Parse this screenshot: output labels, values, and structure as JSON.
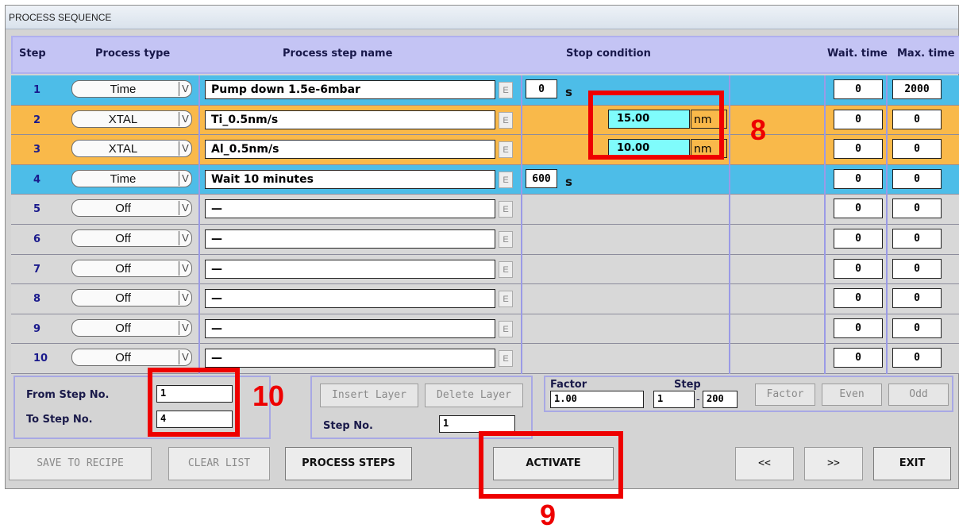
{
  "window": {
    "title": "PROCESS SEQUENCE"
  },
  "header": {
    "step": "Step",
    "process_type": "Process type",
    "process_step_name": "Process step name",
    "stop_condition": "Stop condition",
    "wait_time": "Wait. time",
    "max_time": "Max. time"
  },
  "colors": {
    "time_row": "#4dbde8",
    "xtal_row": "#f9b94a",
    "off_row": "#d8d8d8",
    "xtal_field": "#7ffcfc",
    "annotation": "#ee0000"
  },
  "rows": [
    {
      "step": "1",
      "type": "Time",
      "name": "Pump down 1.5e-6mbar",
      "stop_value": "0",
      "stop_unit": "s",
      "wait": "0",
      "max": "2000",
      "kind": "time"
    },
    {
      "step": "2",
      "type": "XTAL",
      "name": "Ti_0.5nm/s",
      "stop_value": "15.00",
      "stop_unit": "nm",
      "wait": "0",
      "max": "0",
      "kind": "xtal"
    },
    {
      "step": "3",
      "type": "XTAL",
      "name": "Al_0.5nm/s",
      "stop_value": "10.00",
      "stop_unit": "nm",
      "wait": "0",
      "max": "0",
      "kind": "xtal"
    },
    {
      "step": "4",
      "type": "Time",
      "name": "Wait 10 minutes",
      "stop_value": "600",
      "stop_unit": "s",
      "wait": "0",
      "max": "0",
      "kind": "time"
    },
    {
      "step": "5",
      "type": "Off",
      "name": "—",
      "wait": "0",
      "max": "0",
      "kind": "off"
    },
    {
      "step": "6",
      "type": "Off",
      "name": "—",
      "wait": "0",
      "max": "0",
      "kind": "off"
    },
    {
      "step": "7",
      "type": "Off",
      "name": "—",
      "wait": "0",
      "max": "0",
      "kind": "off"
    },
    {
      "step": "8",
      "type": "Off",
      "name": "—",
      "wait": "0",
      "max": "0",
      "kind": "off"
    },
    {
      "step": "9",
      "type": "Off",
      "name": "—",
      "wait": "0",
      "max": "0",
      "kind": "off"
    },
    {
      "step": "10",
      "type": "Off",
      "name": "—",
      "wait": "0",
      "max": "0",
      "kind": "off"
    }
  ],
  "edit_button_label": "E",
  "dropdown_arrow": "V",
  "range": {
    "from_label": "From Step No.",
    "from_value": "1",
    "to_label": "To Step No.",
    "to_value": "4"
  },
  "layer": {
    "insert": "Insert Layer",
    "delete": "Delete Layer",
    "step_no_label": "Step No.",
    "step_no_value": "1"
  },
  "factor": {
    "factor_label": "Factor",
    "step_label": "Step",
    "factor_value": "1.00",
    "step_from": "1",
    "step_to": "200",
    "factor_btn": "Factor",
    "even_btn": "Even",
    "odd_btn": "Odd",
    "dash": "-"
  },
  "buttons": {
    "save": "SAVE TO RECIPE",
    "clear": "CLEAR LIST",
    "process_steps": "PROCESS STEPS",
    "activate": "ACTIVATE",
    "prev": "<<",
    "next": ">>",
    "exit": "EXIT"
  },
  "annotations": {
    "a8": "8",
    "a9": "9",
    "a10": "10"
  }
}
